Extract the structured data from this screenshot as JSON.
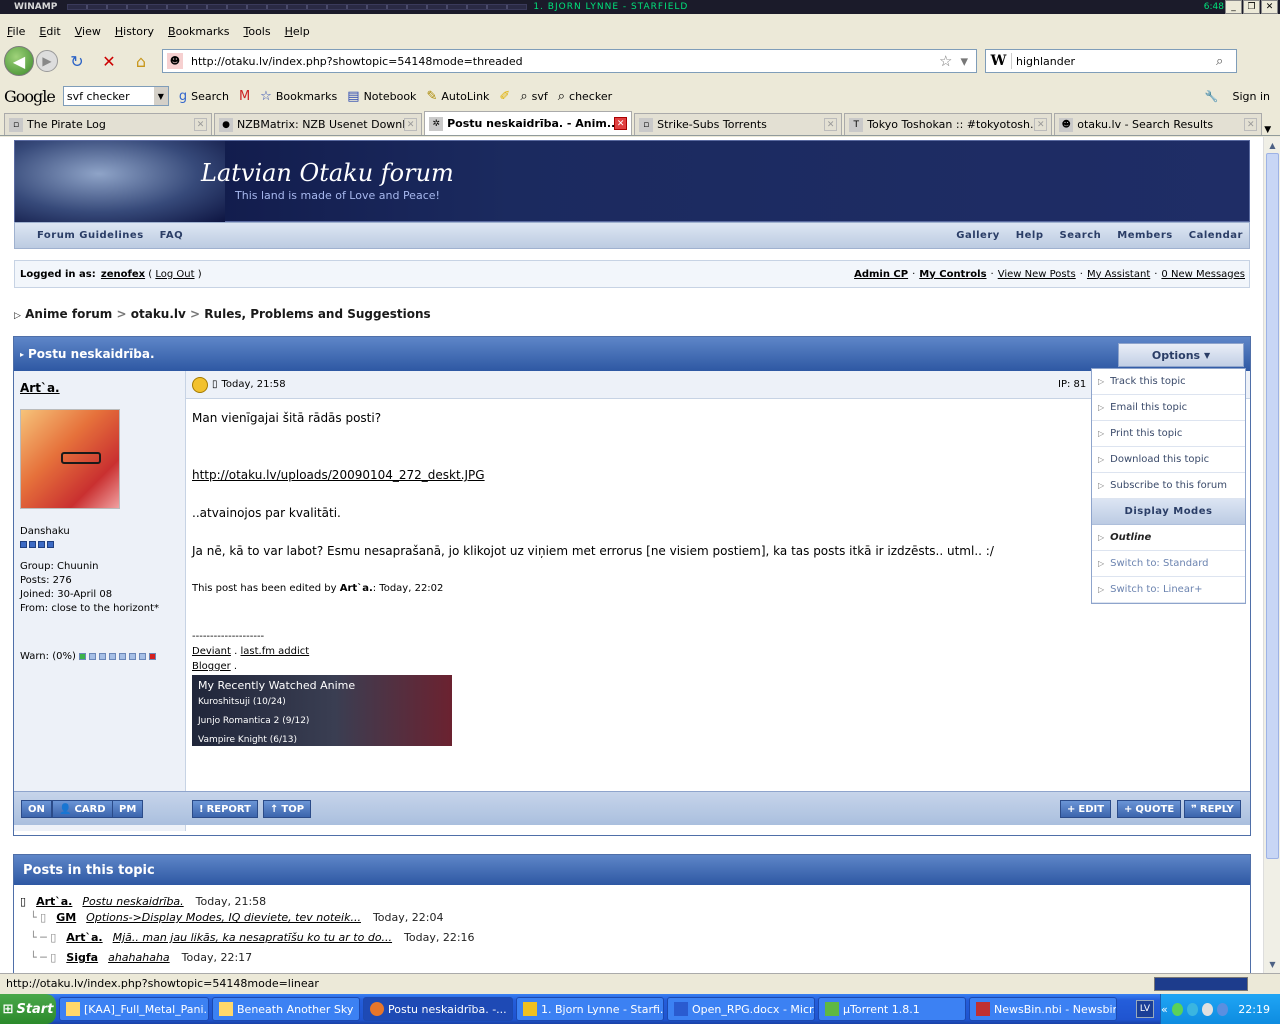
{
  "winamp": {
    "title": "WINAMP",
    "song": "1. BJORN LYNNE - STARFIELD",
    "time": "6:48"
  },
  "menu": [
    "File",
    "Edit",
    "View",
    "History",
    "Bookmarks",
    "Tools",
    "Help"
  ],
  "nav": {
    "url": "http://otaku.lv/index.php?showtopic=54148mode=threaded",
    "search_value": "highlander"
  },
  "google": {
    "logo": "Google",
    "query": "svf checker",
    "search": "Search",
    "bookmarks": "Bookmarks",
    "notebook": "Notebook",
    "autolink": "AutoLink",
    "svf": "svf",
    "checker": "checker",
    "signin": "Sign in"
  },
  "tabs": [
    {
      "label": "The Pirate Log"
    },
    {
      "label": "NZBMatrix: NZB Usenet Downl..."
    },
    {
      "label": "Postu neskaidrība. - Anim..."
    },
    {
      "label": "Strike-Subs Torrents"
    },
    {
      "label": "Tokyo Toshokan :: #tokyotosh..."
    },
    {
      "label": "otaku.lv - Search Results"
    }
  ],
  "forum": {
    "banner_title": "Latvian Otaku forum",
    "banner_sub": "This land is made of Love and Peace!",
    "nav_left": [
      "Forum Guidelines",
      "FAQ"
    ],
    "nav_right": [
      "Gallery",
      "Help",
      "Search",
      "Members",
      "Calendar"
    ],
    "logged_as": "Logged in as:",
    "user": "zenofex",
    "logout": "Log Out",
    "user_links": [
      "Admin CP",
      "My Controls",
      "View New Posts",
      "My Assistant",
      "0 New Messages"
    ],
    "breadcrumb": [
      "Anime forum",
      "otaku.lv",
      "Rules, Problems and Suggestions"
    ],
    "topic_title": "Postu neskaidrība.",
    "options_label": "Options"
  },
  "post": {
    "author": "Art`a.",
    "rank": "Danshaku",
    "group": "Group: Chuunin",
    "posts": "Posts: 276",
    "joined": "Joined: 30-April 08",
    "from": "From: close to the horizont*",
    "warn": "Warn: (0%)",
    "date": "Today, 21:58",
    "ip": "IP: 81",
    "line1": "Man vienīgajai šitā rādās posti?",
    "link": "http://otaku.lv/uploads/20090104_272_deskt.JPG",
    "line2": "..atvainojos par kvalitāti.",
    "line3": "Ja nē, kā to var labot? Esmu nesaprašanā, jo klikojot uz viņiem met errorus [ne visiem postiem], ka tas posts itkā ir izdzēsts.. utml.. :/",
    "edited_prefix": "This post has been edited by",
    "edited_by": "Art`a.",
    "edited_time": ": Today, 22:02",
    "sig_line": "--------------------",
    "sig_deviant": "Deviant",
    "sig_lastfm": "last.fm addict",
    "sig_blogger": "Blogger",
    "anime_title": "My Recently Watched Anime",
    "anime": [
      "Kuroshitsuji (10/24)",
      "Junjo Romantica 2 (9/12)",
      "Vampire Knight (6/13)"
    ],
    "btn_on": "ON",
    "btn_card": "CARD",
    "btn_pm": "PM",
    "btn_report": "REPORT",
    "btn_top": "TOP",
    "btn_edit": "EDIT",
    "btn_quote": "QUOTE",
    "btn_reply": "REPLY"
  },
  "options_menu": {
    "items": [
      "Track this topic",
      "Email this topic",
      "Print this topic",
      "Download this topic",
      "Subscribe to this forum"
    ],
    "header": "Display Modes",
    "modes": [
      "Outline",
      "Switch to: Standard",
      "Switch to: Linear+"
    ]
  },
  "topic_posts": {
    "title": "Posts in this topic",
    "rows": [
      {
        "author": "Art`a.",
        "title": "Postu neskaidrība.",
        "time": "Today, 21:58"
      },
      {
        "author": "GM",
        "title": "Options->Display Modes, IQ dieviete, tev noteik...",
        "time": "Today, 22:04"
      },
      {
        "author": "Art`a.",
        "title": "Mjā.. man jau likās, ka nesapratīšu ko tu ar to do...",
        "time": "Today, 22:16"
      },
      {
        "author": "Sigfa",
        "title": "ahahahaha",
        "time": "Today, 22:17"
      }
    ]
  },
  "status_text": "http://otaku.lv/index.php?showtopic=54148mode=linear",
  "taskbar": {
    "start": "Start",
    "tasks": [
      "[KAA]_Full_Metal_Pani...",
      "Beneath Another Sky",
      "Postu neskaidrība. -...",
      "1. Bjorn Lynne - Starfi...",
      "Open_RPG.docx - Micr...",
      "µTorrent 1.8.1",
      "NewsBin.nbi - Newsbin..."
    ],
    "lang": "LV",
    "clock": "22:19"
  }
}
